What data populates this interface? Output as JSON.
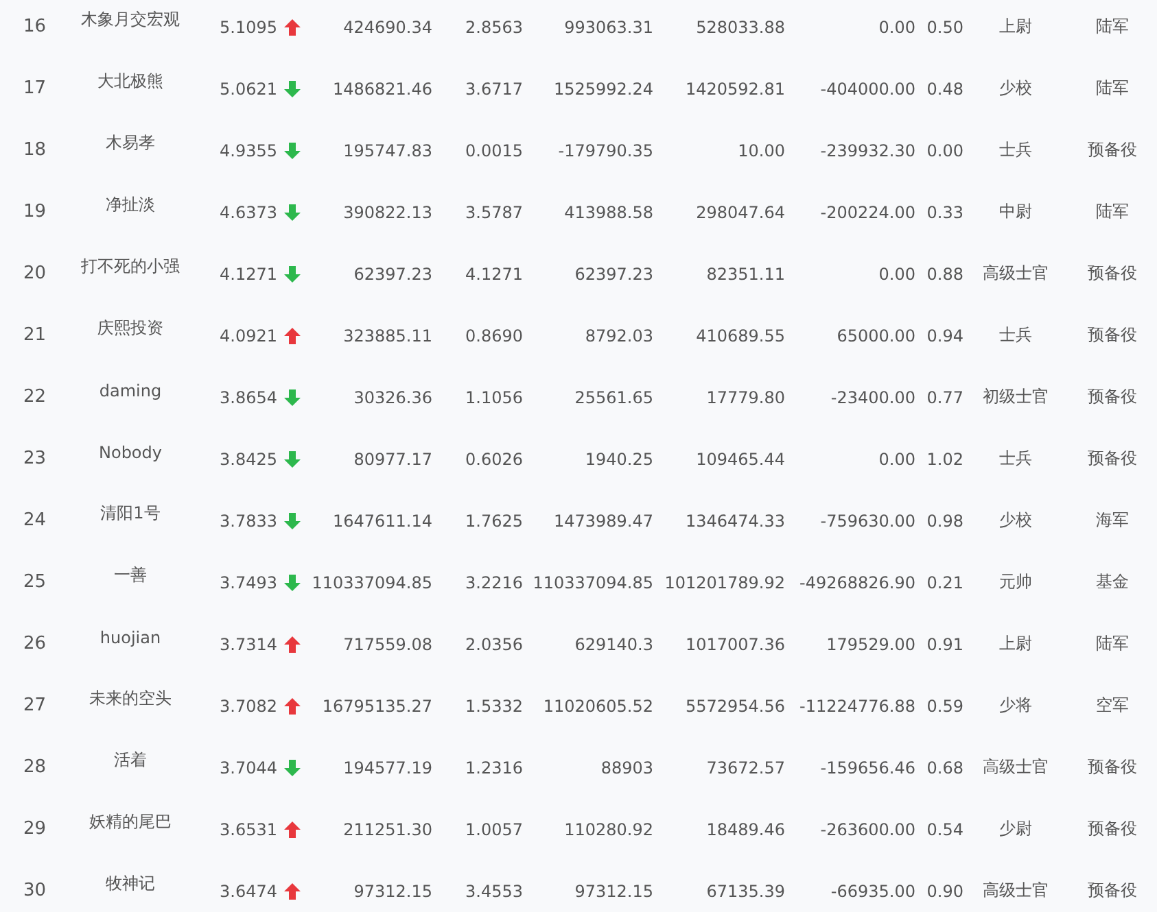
{
  "rows": [
    {
      "rank": "16",
      "name": "木象月交宏观",
      "score": "5.1095",
      "arrow": {
        "kind": "up"
      },
      "column_4": "424690.34",
      "column_5": "2.8563",
      "column_6": "993063.31",
      "column_7": "528033.88",
      "column_8": "0.00",
      "column_9": "0.50",
      "rank_title": "上尉",
      "branch": "陆军"
    },
    {
      "rank": "17",
      "name": "大北极熊",
      "score": "5.0621",
      "arrow": {
        "kind": "down"
      },
      "column_4": "1486821.46",
      "column_5": "3.6717",
      "column_6": "1525992.24",
      "column_7": "1420592.81",
      "column_8": "-404000.00",
      "column_9": "0.48",
      "rank_title": "少校",
      "branch": "陆军"
    },
    {
      "rank": "18",
      "name": "木易孝",
      "score": "4.9355",
      "arrow": {
        "kind": "down"
      },
      "column_4": "195747.83",
      "column_5": "0.0015",
      "column_6": "-179790.35",
      "column_7": "10.00",
      "column_8": "-239932.30",
      "column_9": "0.00",
      "rank_title": "士兵",
      "branch": "预备役"
    },
    {
      "rank": "19",
      "name": "净扯淡",
      "score": "4.6373",
      "arrow": {
        "kind": "down"
      },
      "column_4": "390822.13",
      "column_5": "3.5787",
      "column_6": "413988.58",
      "column_7": "298047.64",
      "column_8": "-200224.00",
      "column_9": "0.33",
      "rank_title": "中尉",
      "branch": "陆军"
    },
    {
      "rank": "20",
      "name": "打不死的小强",
      "score": "4.1271",
      "arrow": {
        "kind": "down"
      },
      "column_4": "62397.23",
      "column_5": "4.1271",
      "column_6": "62397.23",
      "column_7": "82351.11",
      "column_8": "0.00",
      "column_9": "0.88",
      "rank_title": "高级士官",
      "branch": "预备役"
    },
    {
      "rank": "21",
      "name": "庆熙投资",
      "score": "4.0921",
      "arrow": {
        "kind": "up"
      },
      "column_4": "323885.11",
      "column_5": "0.8690",
      "column_6": "8792.03",
      "column_7": "410689.55",
      "column_8": "65000.00",
      "column_9": "0.94",
      "rank_title": "士兵",
      "branch": "预备役"
    },
    {
      "rank": "22",
      "name": "daming",
      "score": "3.8654",
      "arrow": {
        "kind": "down"
      },
      "column_4": "30326.36",
      "column_5": "1.1056",
      "column_6": "25561.65",
      "column_7": "17779.80",
      "column_8": "-23400.00",
      "column_9": "0.77",
      "rank_title": "初级士官",
      "branch": "预备役"
    },
    {
      "rank": "23",
      "name": "Nobody",
      "score": "3.8425",
      "arrow": {
        "kind": "down"
      },
      "column_4": "80977.17",
      "column_5": "0.6026",
      "column_6": "1940.25",
      "column_7": "109465.44",
      "column_8": "0.00",
      "column_9": "1.02",
      "rank_title": "士兵",
      "branch": "预备役"
    },
    {
      "rank": "24",
      "name": "清阳1号",
      "score": "3.7833",
      "arrow": {
        "kind": "down"
      },
      "column_4": "1647611.14",
      "column_5": "1.7625",
      "column_6": "1473989.47",
      "column_7": "1346474.33",
      "column_8": "-759630.00",
      "column_9": "0.98",
      "rank_title": "少校",
      "branch": "海军"
    },
    {
      "rank": "25",
      "name": "一善",
      "score": "3.7493",
      "arrow": {
        "kind": "down"
      },
      "column_4": "110337094.85",
      "column_5": "3.2216",
      "column_6": "110337094.85",
      "column_7": "101201789.92",
      "column_8": "-49268826.90",
      "column_9": "0.21",
      "rank_title": "元帅",
      "branch": "基金"
    },
    {
      "rank": "26",
      "name": "huojian",
      "score": "3.7314",
      "arrow": {
        "kind": "up"
      },
      "column_4": "717559.08",
      "column_5": "2.0356",
      "column_6": "629140.3",
      "column_7": "1017007.36",
      "column_8": "179529.00",
      "column_9": "0.91",
      "rank_title": "上尉",
      "branch": "陆军"
    },
    {
      "rank": "27",
      "name": "未来的空头",
      "score": "3.7082",
      "arrow": {
        "kind": "up"
      },
      "column_4": "16795135.27",
      "column_5": "1.5332",
      "column_6": "11020605.52",
      "column_7": "5572954.56",
      "column_8": "-11224776.88",
      "column_9": "0.59",
      "rank_title": "少将",
      "branch": "空军"
    },
    {
      "rank": "28",
      "name": "活着",
      "score": "3.7044",
      "arrow": {
        "kind": "down"
      },
      "column_4": "194577.19",
      "column_5": "1.2316",
      "column_6": "88903",
      "column_7": "73672.57",
      "column_8": "-159656.46",
      "column_9": "0.68",
      "rank_title": "高级士官",
      "branch": "预备役"
    },
    {
      "rank": "29",
      "name": "妖精的尾巴",
      "score": "3.6531",
      "arrow": {
        "kind": "up"
      },
      "column_4": "211251.30",
      "column_5": "1.0057",
      "column_6": "110280.92",
      "column_7": "18489.46",
      "column_8": "-263600.00",
      "column_9": "0.54",
      "rank_title": "少尉",
      "branch": "预备役"
    },
    {
      "rank": "30",
      "name": "牧神记",
      "score": "3.6474",
      "arrow": {
        "kind": "up"
      },
      "column_4": "97312.15",
      "column_5": "3.4553",
      "column_6": "97312.15",
      "column_7": "67135.39",
      "column_8": "-66935.00",
      "column_9": "0.90",
      "rank_title": "高级士官",
      "branch": "预备役"
    }
  ]
}
